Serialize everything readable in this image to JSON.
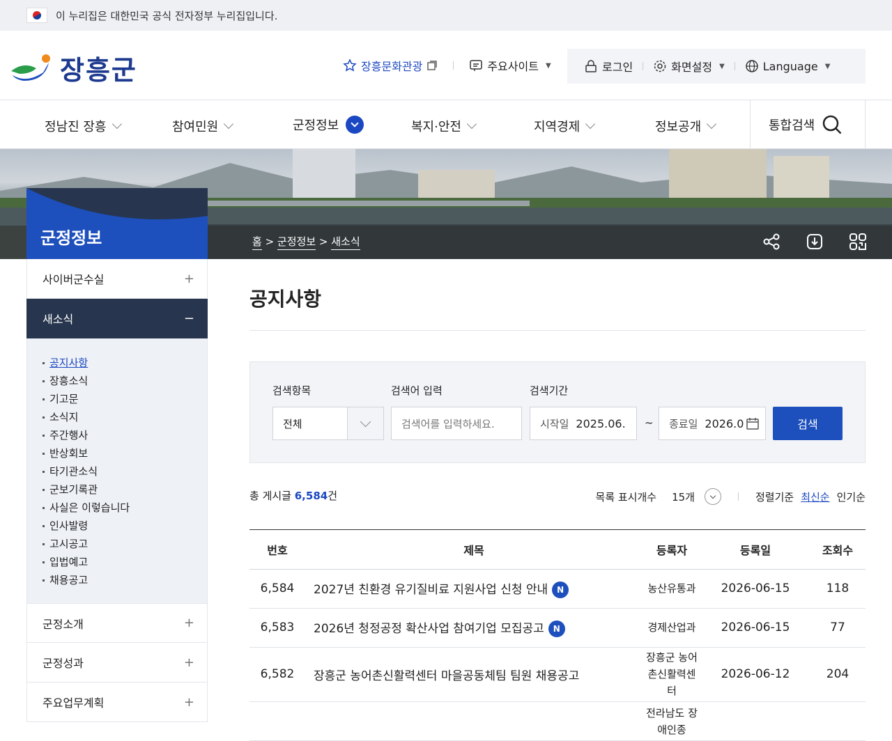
{
  "gov_banner": {
    "text": "이 누리집은 대한민국 공식 전자정부 누리집입니다."
  },
  "header": {
    "logo": "장흥군",
    "culture_link": "장흥문화관광",
    "main_sites": "주요사이트",
    "login": "로그인",
    "screen_settings": "화면설정",
    "language": "Language"
  },
  "gnb": {
    "items": [
      {
        "label": "정남진 장흥",
        "active": false
      },
      {
        "label": "참여민원",
        "active": false
      },
      {
        "label": "군정정보",
        "active": true
      },
      {
        "label": "복지·안전",
        "active": false
      },
      {
        "label": "지역경제",
        "active": false
      },
      {
        "label": "정보공개",
        "active": false
      }
    ],
    "search_label": "통합검색"
  },
  "visual": {
    "section_title": "군정정보",
    "breadcrumb": [
      "홈",
      "군정정보",
      "새소식"
    ]
  },
  "sidebar": {
    "menus": [
      {
        "label": "사이버군수실"
      },
      {
        "label": "새소식"
      }
    ],
    "sub": [
      "공지사항",
      "장흥소식",
      "기고문",
      "소식지",
      "주간행사",
      "반상회보",
      "타기관소식",
      "군보기록관",
      "사실은 이렇습니다",
      "인사발령",
      "고시공고",
      "입법예고",
      "채용공고"
    ],
    "bottom": [
      {
        "label": "군정소개"
      },
      {
        "label": "군정성과"
      },
      {
        "label": "주요업무계획"
      }
    ]
  },
  "page": {
    "title": "공지사항"
  },
  "search": {
    "category_label": "검색항목",
    "category_value": "전체",
    "keyword_label": "검색어 입력",
    "keyword_placeholder": "검색어를 입력하세요.",
    "period_label": "검색기간",
    "start_label": "시작일",
    "start_value": "2025.06.",
    "tilde": "~",
    "end_label": "종료일",
    "end_value": "2026.0",
    "button": "검색"
  },
  "list_info": {
    "total_prefix": "총 게시글 ",
    "total_count": "6,584",
    "total_suffix": "건",
    "per_page_label": "목록 표시개수",
    "per_page_value": "15개",
    "sort_label": "정렬기준",
    "sort_latest": "최신순",
    "sort_popular": "인기순"
  },
  "table": {
    "headers": [
      "번호",
      "제목",
      "등록자",
      "등록일",
      "조회수"
    ],
    "rows": [
      {
        "no": "6,584",
        "title": "2027년 친환경 유기질비료 지원사업 신청 안내",
        "new": "N",
        "author": "농산유통과",
        "date": "2026-06-15",
        "views": "118"
      },
      {
        "no": "6,583",
        "title": "2026년 청정공정 확산사업 참여기업 모집공고",
        "new": "N",
        "author": "경제산업과",
        "date": "2026-06-15",
        "views": "77"
      },
      {
        "no": "6,582",
        "title": "장흥군 농어촌신활력센터 마을공동체팀 팀원 채용공고",
        "new": "",
        "author": "장흥군 농어촌신활력센터",
        "date": "2026-06-12",
        "views": "204"
      },
      {
        "no": "",
        "title": "",
        "new": "",
        "author": "전라남도 장애인종",
        "date": "",
        "views": ""
      }
    ]
  }
}
